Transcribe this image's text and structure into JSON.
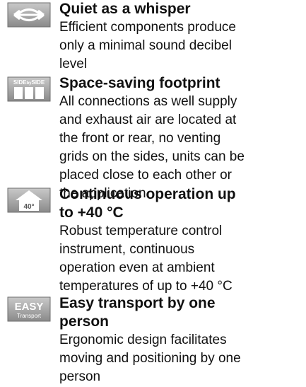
{
  "features": [
    {
      "icon": "quiet-operation-icon",
      "title": "Quiet as a whisper",
      "description": "Efficient components produce only a minimal sound decibel level"
    },
    {
      "icon": "side-by-side-icon",
      "icon_text": "SIDE by SIDE",
      "title": "Space-saving footprint",
      "description": "All connections as well supply and exhaust air are located at the front or rear, no venting grids on the sides, units can be placed close to each other or the application"
    },
    {
      "icon": "temperature-40-icon",
      "icon_text": "40°",
      "title": "Continuous operation up to +40 °C",
      "description": "Robust temperature control instrument, continuous operation even at ambient temperatures of up to +40 °C"
    },
    {
      "icon": "easy-transport-icon",
      "icon_text": "EASY Transport",
      "title": "Easy transport by one person",
      "description": "Ergonomic design facilitates moving and positioning by one person"
    }
  ]
}
